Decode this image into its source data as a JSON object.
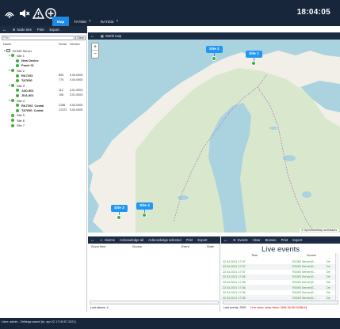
{
  "topbar": {
    "icons": [
      "signal-icon",
      "mute-icon",
      "warning-icon",
      "add-icon"
    ],
    "tabs": [
      {
        "label": "Map",
        "active": true,
        "closable": false
      },
      {
        "label": "TA7650",
        "active": false,
        "closable": true,
        "close_glyph": "×"
      },
      {
        "label": "RA7203",
        "active": false,
        "closable": true,
        "close_glyph": "×"
      }
    ],
    "clock": "18:04:05",
    "accent_color": "#1e88e5",
    "bar_color": "#17263a"
  },
  "left_toolbar": {
    "node_tree": "Node tree",
    "print": "Print",
    "export": "Export"
  },
  "map_toolbar": {
    "world_map": "World map"
  },
  "tree": {
    "filter_placeholder": "Filter",
    "clear": "Clear",
    "columns": {
      "name": "Name",
      "serial": "Serial",
      "version": "Version"
    },
    "rows": [
      {
        "label": "RCMS Server",
        "type": "server",
        "caret": "▾",
        "serial": "",
        "version": "",
        "bold": false
      },
      {
        "label": "Site 1",
        "type": "site",
        "caret": "▾",
        "serial": "",
        "version": "",
        "bold": false
      },
      {
        "label": "New Device",
        "type": "device",
        "caret": "",
        "serial": "",
        "version": "",
        "bold": true
      },
      {
        "label": "Panel 01",
        "type": "device",
        "caret": "",
        "serial": "",
        "version": "",
        "bold": true
      },
      {
        "label": "Site 2",
        "type": "site",
        "caret": "▾",
        "serial": "",
        "version": "",
        "bold": false
      },
      {
        "label": "RA7203",
        "type": "device",
        "caret": "",
        "serial": "655",
        "version": "5.04.0006",
        "bold": true
      },
      {
        "label": "TA7650",
        "type": "device",
        "caret": "",
        "serial": "776",
        "version": "5.04.0006",
        "bold": true
      },
      {
        "label": "Site 3",
        "type": "site",
        "caret": "▾",
        "serial": "",
        "version": "",
        "bold": false
      },
      {
        "label": "JAD-801",
        "type": "device",
        "caret": "",
        "serial": "112",
        "version": "3.01.0004",
        "bold": true
      },
      {
        "label": "JDA-801",
        "type": "device",
        "caret": "",
        "serial": "108",
        "version": "3.01.0004",
        "bold": true
      },
      {
        "label": "Site 4",
        "type": "site",
        "caret": "▾",
        "serial": "",
        "version": "",
        "bold": false
      },
      {
        "label": "RA7203_Costal",
        "type": "device",
        "caret": "",
        "serial": "2186",
        "version": "5.04.0006",
        "bold": true
      },
      {
        "label": "TA7650_Costal",
        "type": "device",
        "caret": "",
        "serial": "12223",
        "version": "5.04.0006",
        "bold": true
      },
      {
        "label": "Site 5",
        "type": "site",
        "caret": "›",
        "serial": "",
        "version": "",
        "bold": false
      },
      {
        "label": "Site 6",
        "type": "site",
        "caret": "›",
        "serial": "",
        "version": "",
        "bold": false
      },
      {
        "label": "Site 7",
        "type": "site",
        "caret": "›",
        "serial": "",
        "version": "",
        "bold": false
      }
    ],
    "status_color": "#3fae3a"
  },
  "map": {
    "markers": [
      {
        "label": "Site 2",
        "name": "marker-site-2"
      },
      {
        "label": "Site 1",
        "name": "marker-site-1"
      },
      {
        "label": "Site 3",
        "name": "marker-site-3"
      },
      {
        "label": "Site 4",
        "name": "marker-site-4"
      }
    ],
    "attribution": "© OpenStreetMap contributors",
    "zoom_in": "+",
    "zoom_out": "−",
    "water_color": "#aad3df",
    "land_color": "#f1efe8",
    "forest_color": "#cfe6c2",
    "marker_color": "#2196f3"
  },
  "alarms": {
    "toolbar": {
      "alarms": "Alarms",
      "ack_all": "Acknowledge all",
      "ack_selected": "Acknowledge selected",
      "print": "Print",
      "export": "Export"
    },
    "columns": {
      "occur_time": "Occur time",
      "source": "Source",
      "event": "Event",
      "state": "State"
    },
    "last_alarms": "Last alarms: 4"
  },
  "events": {
    "toolbar": {
      "events": "Events",
      "clear": "Clear",
      "browse": "Browse",
      "print": "Print",
      "export": "Export"
    },
    "title": "Live events",
    "columns": {
      "time": "Time",
      "source": "Source"
    },
    "rows": [
      {
        "time": "22.04.2021 17:57",
        "source": "RCMS Server(S...",
        "extra": "De"
      },
      {
        "time": "22.04.2021 17:57",
        "source": "RCMS Server(S...",
        "extra": "De"
      },
      {
        "time": "22.04.2021 17:57",
        "source": "RCMS Server(S...",
        "extra": "De"
      },
      {
        "time": "22.04.2021 17:56",
        "source": "RCMS Server(S...",
        "extra": "De"
      },
      {
        "time": "22.04.2021 17:56",
        "source": "RCMS Server(S...",
        "extra": "De"
      },
      {
        "time": "22.04.2021 17:56",
        "source": "RCMS Server(S...",
        "extra": "De"
      },
      {
        "time": "22.04.2021 17:56",
        "source": "RCMS Server(S...",
        "extra": "De"
      },
      {
        "time": "22.04.2021 17:55",
        "source": "RCMS Server(S...",
        "extra": "De"
      }
    ],
    "last_events": "Last events: 2000",
    "live_view": "Live view: clear from: 2021.02.09 13:58:24",
    "row_color": "#2e9a2e",
    "alert_color": "#e53935"
  },
  "userbar": {
    "text": "User: admin - Settings saved (to: apr 22 17:09:57 2021)"
  }
}
